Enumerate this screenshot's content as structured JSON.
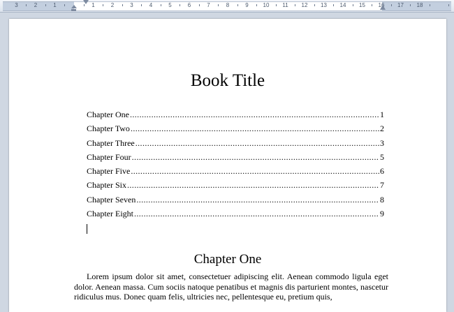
{
  "ruler": {
    "labels": [
      "3",
      "2",
      "1",
      "1",
      "2",
      "3",
      "4",
      "5",
      "6",
      "7",
      "8",
      "9",
      "10",
      "11",
      "12",
      "13",
      "14",
      "15",
      "16",
      "17",
      "18"
    ]
  },
  "document": {
    "book_title": "Book Title",
    "toc": [
      {
        "title": "Chapter One",
        "page": "1"
      },
      {
        "title": "Chapter Two",
        "page": "2"
      },
      {
        "title": "Chapter Three",
        "page": "3"
      },
      {
        "title": "Chapter Four",
        "page": "5"
      },
      {
        "title": "Chapter Five",
        "page": "6"
      },
      {
        "title": "Chapter Six",
        "page": "7"
      },
      {
        "title": "Chapter Seven",
        "page": "8"
      },
      {
        "title": "Chapter Eight",
        "page": "9"
      }
    ],
    "chapter_heading": "Chapter One",
    "body_text": "Lorem ipsum dolor sit amet, consectetuer adipiscing elit. Aenean commodo ligula eget dolor. Aenean massa. Cum sociis natoque penatibus et magnis dis parturient montes, nascetur ridiculus mus. Donec quam felis, ultricies nec, pellentesque eu, pretium quis,"
  }
}
